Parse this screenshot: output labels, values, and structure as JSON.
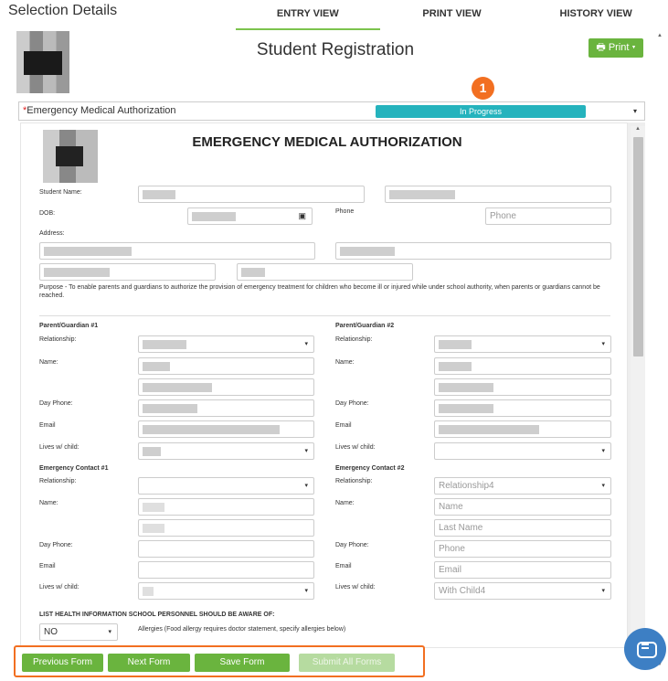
{
  "header": {
    "selection_title": "Selection Details",
    "tabs": [
      {
        "label": "ENTRY VIEW",
        "active": true
      },
      {
        "label": "PRINT VIEW",
        "active": false
      },
      {
        "label": "HISTORY VIEW",
        "active": false
      }
    ]
  },
  "form_header": {
    "title": "Student Registration",
    "print_label": "🖶 Print ▾",
    "badge": "1"
  },
  "form_selector": {
    "required_mark": "*",
    "selected_form": "Emergency Medical Authorization",
    "status": "In Progress",
    "caret": "▾"
  },
  "document": {
    "title": "EMERGENCY MEDICAL AUTHORIZATION",
    "labels": {
      "student_name": "Student Name:",
      "dob": "DOB:",
      "phone": "Phone",
      "address": "Address:"
    },
    "phone_placeholder": "Phone",
    "purpose": "Purpose - To enable parents and guardians to authorize the provision of emergency treatment for children who become ill or injured while under school authority, when parents or guardians cannot be reached.",
    "guardian1": {
      "heading": "Parent/Guardian #1",
      "relationship": "Relationship:",
      "name": "Name:",
      "day_phone": "Day Phone:",
      "email": "Email",
      "lives_with_child": "Lives w/ child:"
    },
    "guardian2": {
      "heading": "Parent/Guardian #2",
      "relationship": "Relationship:",
      "name": "Name:",
      "day_phone": "Day Phone:",
      "email": "Email",
      "lives_with_child": "Lives w/ child:"
    },
    "contact1": {
      "heading": "Emergency Contact #1",
      "relationship": "Relationship:",
      "name": "Name:",
      "day_phone": "Day Phone:",
      "email": "Email",
      "lives_with_child": "Lives w/ child:"
    },
    "contact2": {
      "heading": "Emergency Contact #2",
      "relationship": "Relationship:",
      "name": "Name:",
      "day_phone": "Day Phone:",
      "email": "Email",
      "lives_with_child": "Lives w/ child:",
      "placeholders": {
        "relationship": "Relationship4",
        "name": "Name",
        "last_name": "Last Name",
        "day_phone": "Phone",
        "email": "Email",
        "lives_with_child": "With Child4"
      }
    },
    "health_heading": "LIST HEALTH INFORMATION SCHOOL PERSONNEL SHOULD BE AWARE OF:",
    "allergy_select": "NO",
    "allergy_text": "Allergies (Food allergy requires doctor statement, specify allergies below)"
  },
  "actions": {
    "previous": "Previous Form",
    "next": "Next Form",
    "save": "Save Form",
    "submit": "Submit All Forms"
  },
  "colors": {
    "accent_green": "#6ab43e",
    "status_teal": "#25b3bd",
    "highlight_orange": "#f26f21",
    "chat_blue": "#3d7fc4"
  }
}
